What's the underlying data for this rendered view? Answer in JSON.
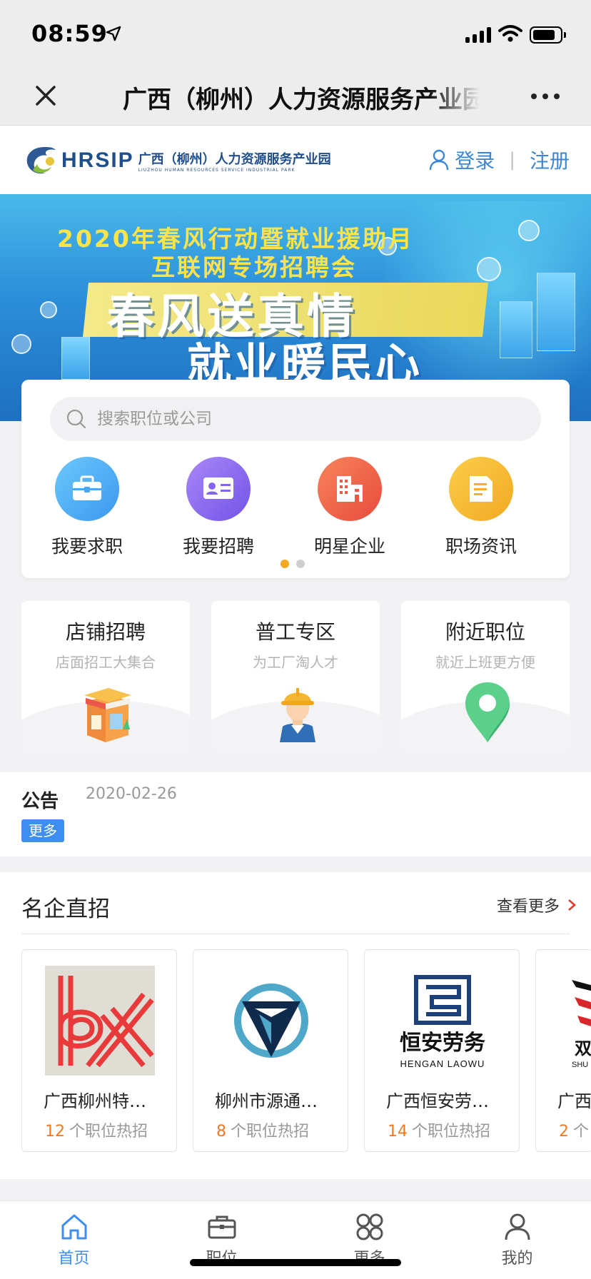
{
  "status_bar": {
    "time": "08:59"
  },
  "nav": {
    "title": "广西（柳州）人力资源服务产业园"
  },
  "site": {
    "logo_text": "HRSIP",
    "logo_cn": "广西（柳州）人力资源服务产业园",
    "logo_en": "LIUZHOU HUMAN RESOURCES SERVICE INDUSTRIAL PARK",
    "login": "登录",
    "sep": "|",
    "register": "注册"
  },
  "banner": {
    "line1": "2020年春风行动暨就业援助月",
    "line2": "互联网专场招聘会",
    "line3": "春风送真情",
    "line4": "就业暖民心"
  },
  "search": {
    "placeholder": "搜索职位或公司"
  },
  "quick_items": [
    {
      "label": "我要求职",
      "icon": "briefcase-icon",
      "color": "#4fb0f5"
    },
    {
      "label": "我要招聘",
      "icon": "id-card-icon",
      "color": "#8f6cf0"
    },
    {
      "label": "明星企业",
      "icon": "building-icon",
      "color": "#f0604b"
    },
    {
      "label": "职场资讯",
      "icon": "document-icon",
      "color": "#f5b630"
    }
  ],
  "zones": [
    {
      "title": "店铺招聘",
      "subtitle": "店面招工大集合",
      "icon": "shop-icon"
    },
    {
      "title": "普工专区",
      "subtitle": "为工厂淘人才",
      "icon": "worker-icon"
    },
    {
      "title": "附近职位",
      "subtitle": "就近上班更方便",
      "icon": "location-pin-icon"
    }
  ],
  "notice": {
    "label": "公告",
    "date": "2020-02-26",
    "more": "更多"
  },
  "companies": {
    "title": "名企直招",
    "more": "查看更多",
    "items": [
      {
        "name": "广西柳州特…",
        "count": "12",
        "suffix": "个职位热招"
      },
      {
        "name": "柳州市源通…",
        "count": "8",
        "suffix": "个职位热招"
      },
      {
        "name": "广西恒安劳…",
        "count": "14",
        "suffix": "个职位热招"
      },
      {
        "name": "广西",
        "count": "2",
        "suffix": "个"
      }
    ],
    "logo3_cn": "恒安劳务",
    "logo3_en": "HENGAN LAOWU",
    "logo4_cn": "双",
    "logo4_en": "SHU"
  },
  "tabbar": [
    {
      "label": "首页",
      "icon": "home-icon",
      "active": true
    },
    {
      "label": "职位",
      "icon": "briefcase-icon",
      "active": false
    },
    {
      "label": "更多",
      "icon": "grid-icon",
      "active": false
    },
    {
      "label": "我的",
      "icon": "user-icon",
      "active": false
    }
  ],
  "colors": {
    "accent": "#3d8ef0",
    "count": "#f07a24",
    "dot_active": "#f5a623"
  }
}
